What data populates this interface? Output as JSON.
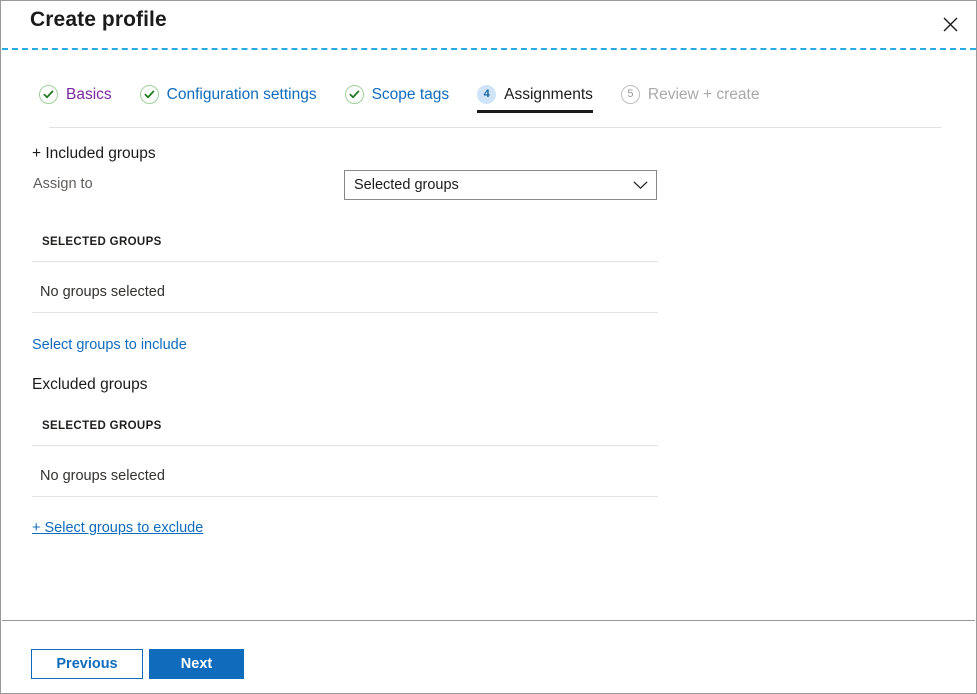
{
  "window": {
    "title": "Create profile",
    "close_icon": "close-icon"
  },
  "wizard": {
    "tabs": [
      {
        "label": "Basics",
        "badge": "✓",
        "state": "visited"
      },
      {
        "label": "Configuration settings",
        "badge": "✓",
        "state": "link"
      },
      {
        "label": "Scope tags",
        "badge": "✓",
        "state": "link"
      },
      {
        "label": "Assignments",
        "badge": "4",
        "state": "current"
      },
      {
        "label": "Review + create",
        "badge": "5",
        "state": "pending"
      }
    ]
  },
  "included": {
    "heading": "+ Included groups",
    "assign_to_label": "Assign to",
    "assign_to_value": "Selected groups",
    "assign_to_options": [
      "Selected groups"
    ],
    "column_header": "SELECTED GROUPS",
    "empty_text": "No groups selected",
    "select_link": "Select groups to include"
  },
  "excluded": {
    "heading": "Excluded groups",
    "column_header": "SELECTED GROUPS",
    "empty_text": "No groups selected",
    "select_link": "+ Select groups to exclude"
  },
  "footer": {
    "previous_label": "Previous",
    "next_label": "Next"
  },
  "colors": {
    "accent_blue": "#0f6cbd",
    "visited_purple": "#7b27a1",
    "check_green": "#107c10",
    "badge_blue_bg": "#cfe4f7",
    "dashed_rule": "#29ABE2",
    "active_underline": "#1b1b1b"
  }
}
